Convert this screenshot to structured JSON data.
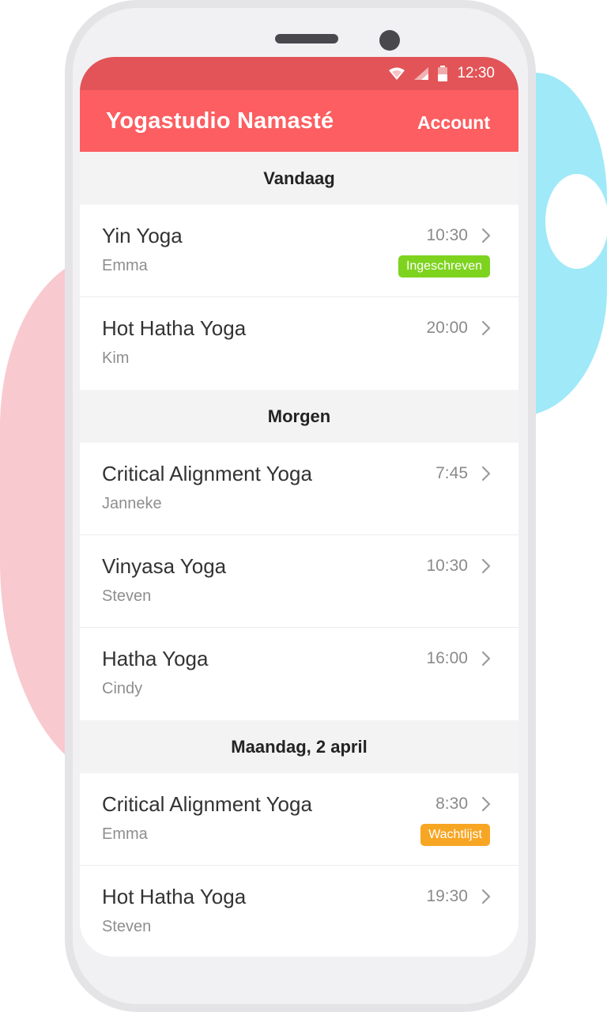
{
  "status_bar": {
    "time": "12:30",
    "icons": [
      "wifi-icon",
      "signal-icon",
      "battery-icon"
    ]
  },
  "app_bar": {
    "title": "Yogastudio Namasté",
    "account_label": "Account"
  },
  "colors": {
    "status_bar": "#e25457",
    "app_bar": "#fc5e61",
    "badge_ingeschreven": "#7ed31f",
    "badge_wachtlijst": "#f7a624"
  },
  "sections": [
    {
      "title": "Vandaag",
      "classes": [
        {
          "name": "Yin Yoga",
          "teacher": "Emma",
          "time": "10:30",
          "badge": "Ingeschreven"
        },
        {
          "name": "Hot Hatha Yoga",
          "teacher": "Kim",
          "time": "20:00"
        }
      ]
    },
    {
      "title": "Morgen",
      "classes": [
        {
          "name": "Critical Alignment Yoga",
          "teacher": "Janneke",
          "time": "7:45"
        },
        {
          "name": "Vinyasa Yoga",
          "teacher": "Steven",
          "time": "10:30"
        },
        {
          "name": "Hatha Yoga",
          "teacher": "Cindy",
          "time": "16:00"
        }
      ]
    },
    {
      "title": "Maandag, 2 april",
      "classes": [
        {
          "name": "Critical Alignment Yoga",
          "teacher": "Emma",
          "time": "8:30",
          "badge": "Wachtlijst"
        },
        {
          "name": "Hot Hatha Yoga",
          "teacher": "Steven",
          "time": "19:30"
        }
      ]
    }
  ]
}
